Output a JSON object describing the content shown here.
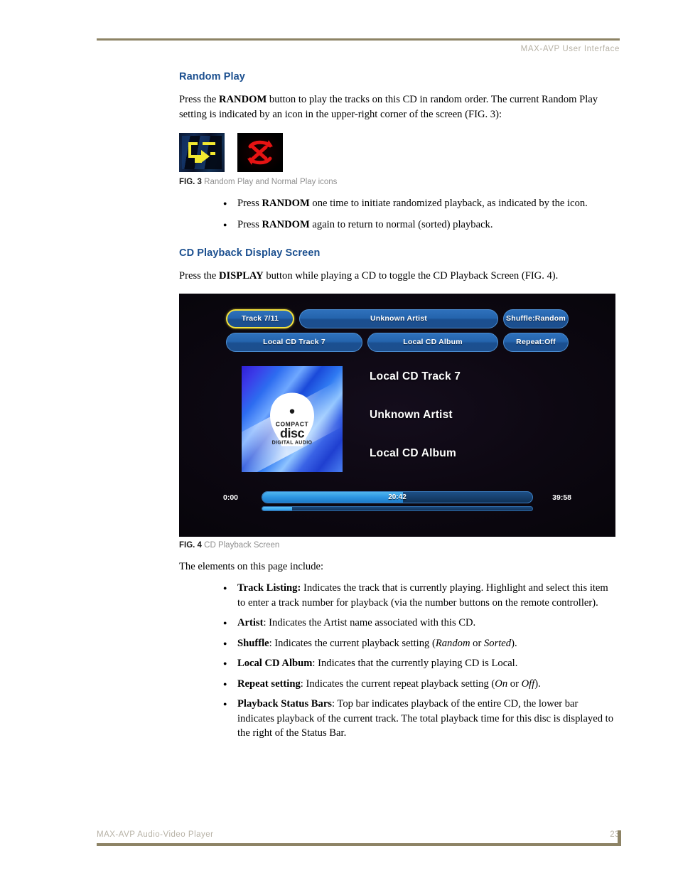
{
  "header": {
    "title": "MAX-AVP User Interface"
  },
  "footer": {
    "doc_title": "MAX-AVP Audio-Video Player",
    "page_number": "23"
  },
  "sections": {
    "random_play": {
      "heading": "Random Play",
      "intro_before_bold": "Press the ",
      "intro_bold": "RANDOM",
      "intro_after_bold": " button to play the tracks on this CD in random order. The current Random Play setting is indicated by an icon in the upper-right corner of the screen (FIG. 3):",
      "fig3": {
        "number": "FIG. 3",
        "caption": "Random Play and Normal Play icons",
        "icons": [
          {
            "name": "random-play-icon",
            "color": "#f2e830"
          },
          {
            "name": "normal-play-icon",
            "color": "#e61313"
          }
        ]
      },
      "bullets": [
        {
          "pre": "Press ",
          "bold": "RANDOM",
          "post": " one time to initiate randomized playback, as indicated by the icon."
        },
        {
          "pre": "Press ",
          "bold": "RANDOM",
          "post": " again to return to normal (sorted) playback."
        }
      ]
    },
    "cd_playback": {
      "heading": "CD Playback Display Screen",
      "intro_before_bold": "Press the ",
      "intro_bold": "DISPLAY",
      "intro_after_bold": " button while playing a CD to toggle the CD Playback Screen (FIG. 4).",
      "fig4": {
        "number": "FIG. 4",
        "caption": "CD Playback Screen"
      },
      "elements_lead": "The elements on this page include:",
      "element_bullets": [
        {
          "bold": "Track Listing:",
          "rest": " Indicates the track that is currently playing. Highlight and select this item to enter a track number for playback (via the number buttons on the remote controller)."
        },
        {
          "bold": "Artist",
          "rest": ": Indicates the Artist name associated with this CD."
        },
        {
          "bold": "Shuffle",
          "rest": ": Indicates the current playback setting (",
          "em1": "Random",
          "mid": " or ",
          "em2": "Sorted",
          "tail": ")."
        },
        {
          "bold": "Local CD Album",
          "rest": ": Indicates that the currently playing CD is Local."
        },
        {
          "bold": "Repeat setting",
          "rest": ": Indicates the current repeat playback setting (",
          "em1": "On",
          "mid": " or ",
          "em2": "Off",
          "tail": ")."
        },
        {
          "bold": "Playback Status Bars",
          "rest": ": Top bar indicates playback of the entire CD, the lower bar indicates playback of the current track. The total playback time for this disc is displayed to the right of the Status Bar."
        }
      ]
    }
  },
  "cd_screen": {
    "buttons_row1": [
      {
        "label": "Track 7/11",
        "selected": true
      },
      {
        "label": "Unknown Artist",
        "selected": false
      },
      {
        "label": "Shuffle:Random",
        "selected": false
      }
    ],
    "buttons_row2": [
      {
        "label": "Local CD Track 7",
        "selected": false
      },
      {
        "label": "Local CD Album",
        "selected": false
      },
      {
        "label": "Repeat:Off",
        "selected": false
      }
    ],
    "album_art": {
      "logo_top": "COMPACT",
      "logo_mid": "disc",
      "logo_bottom": "DIGITAL AUDIO"
    },
    "now_playing": {
      "track": "Local CD Track 7",
      "artist": "Unknown Artist",
      "album": "Local CD Album"
    },
    "progress": {
      "start_time": "0:00",
      "current_time": "20:42",
      "total_time": "39:58",
      "disc_percent": 52,
      "track_percent": 11
    },
    "colors": {
      "button_blue": "#2464ad",
      "selection_yellow": "#f5e33c",
      "bar_blue": "#2d95e2"
    }
  }
}
